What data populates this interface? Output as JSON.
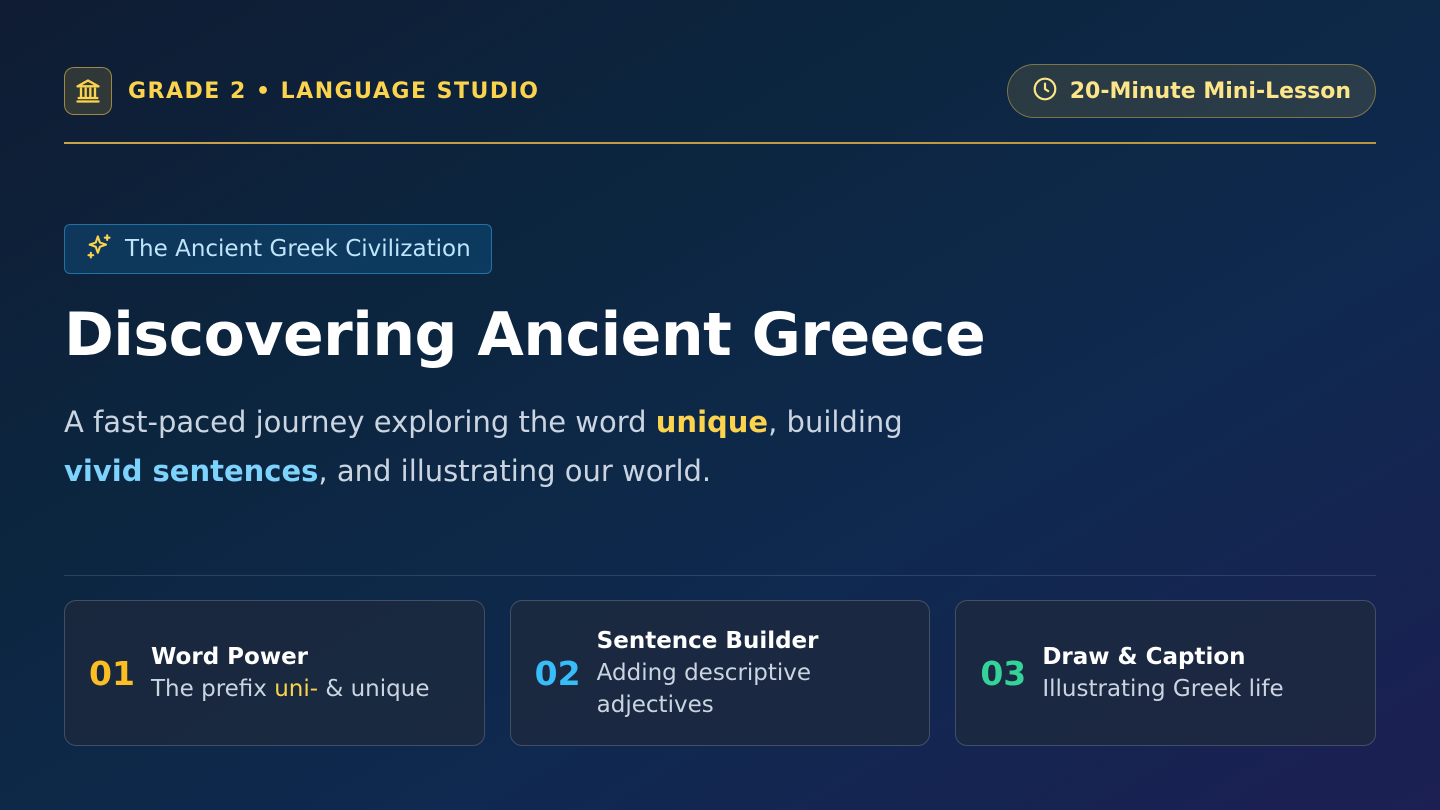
{
  "header": {
    "brand": "GRADE 2 • LANGUAGE STUDIO",
    "icon": "bank-columns-icon",
    "duration_icon": "clock-icon",
    "duration": "20-Minute Mini-Lesson"
  },
  "topic": {
    "icon": "sparkles-icon",
    "label": "The Ancient Greek Civilization"
  },
  "title": "Discovering Ancient Greece",
  "subtitle": {
    "part1": "A fast-paced journey exploring the word ",
    "highlight1": "unique",
    "part2": ", building ",
    "highlight2": "vivid sentences",
    "part3": ", and illustrating our world."
  },
  "cards": [
    {
      "number": "01",
      "title": "Word Power",
      "desc_before": "The prefix ",
      "desc_highlight": "uni-",
      "desc_after": " & unique"
    },
    {
      "number": "02",
      "title": "Sentence Builder",
      "desc": "Adding descriptive adjectives"
    },
    {
      "number": "03",
      "title": "Draw & Caption",
      "desc": "Illustrating Greek life"
    }
  ],
  "colors": {
    "gold": "#fcd34d",
    "blue": "#38bdf8",
    "green": "#34d399",
    "background": "#0f2640"
  }
}
